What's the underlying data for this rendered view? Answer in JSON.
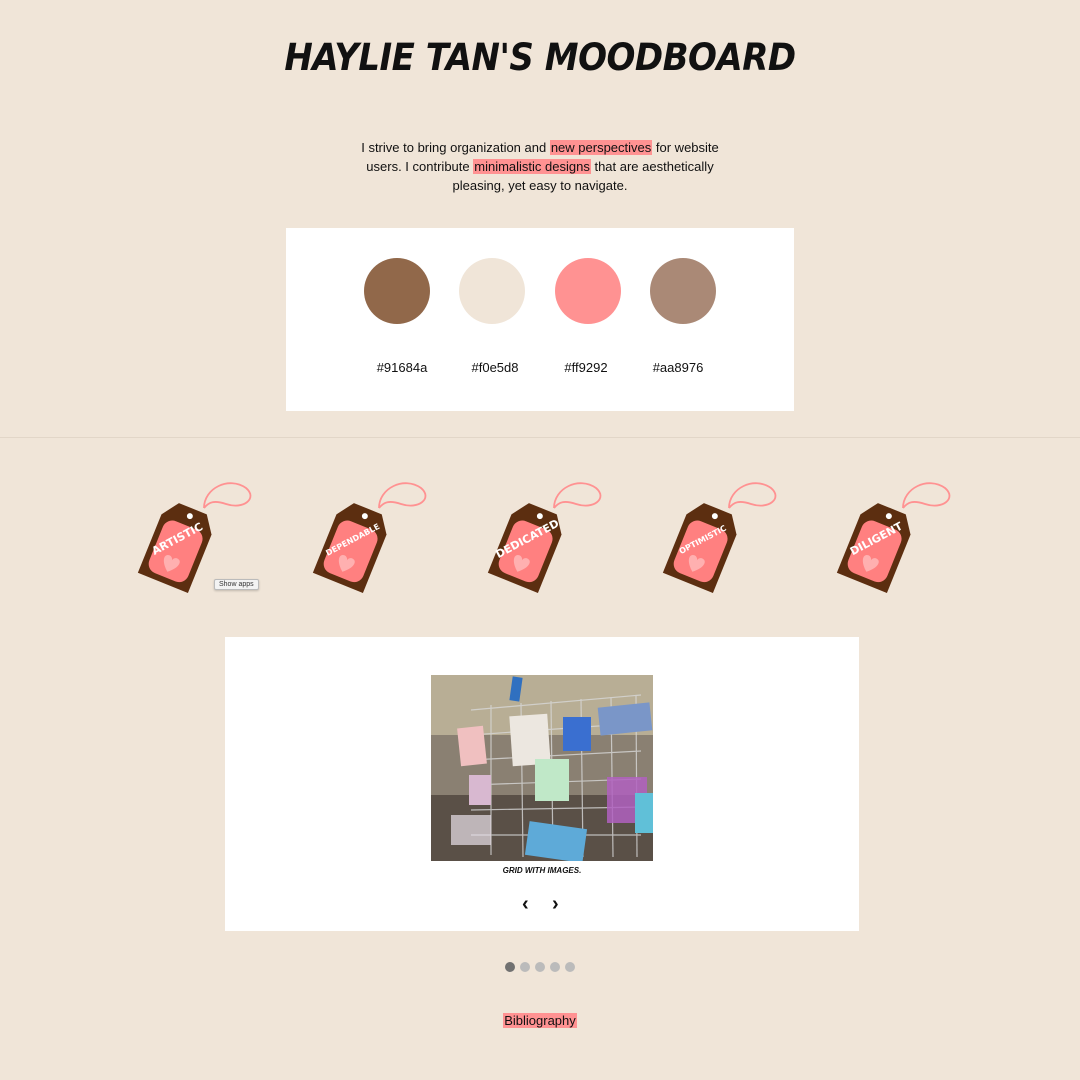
{
  "page": {
    "title": "Haylie Tan's Moodboard"
  },
  "intro": {
    "part1": "I strive to bring organization and ",
    "highlight1": "new perspectives",
    "part2": " for website users. I contribute ",
    "highlight2": "minimalistic designs",
    "part3": " that are aesthetically pleasing, yet easy to navigate."
  },
  "palette": {
    "colors": [
      {
        "hex": "#91684a",
        "label": "#91684a"
      },
      {
        "hex": "#f0e5d8",
        "label": "#f0e5d8"
      },
      {
        "hex": "#ff9292",
        "label": "#ff9292"
      },
      {
        "hex": "#aa8976",
        "label": "#aa8976"
      }
    ]
  },
  "traits": {
    "tags": [
      "ARTISTIC",
      "DEPENDABLE",
      "DEDICATED",
      "OPTIMISTIC",
      "DILIGENT"
    ],
    "tag_colors": {
      "outer": "#5c2e10",
      "inner": "#ff8080",
      "string": "#ff9292",
      "heart": "#ffb0b0"
    }
  },
  "tooltip": {
    "text": "Show apps"
  },
  "slideshow": {
    "caption": "Grid with images.",
    "prev_label": "‹",
    "next_label": "›",
    "dot_count": 5,
    "active_index": 0
  },
  "footer": {
    "bibliography_label": "Bibliography"
  }
}
